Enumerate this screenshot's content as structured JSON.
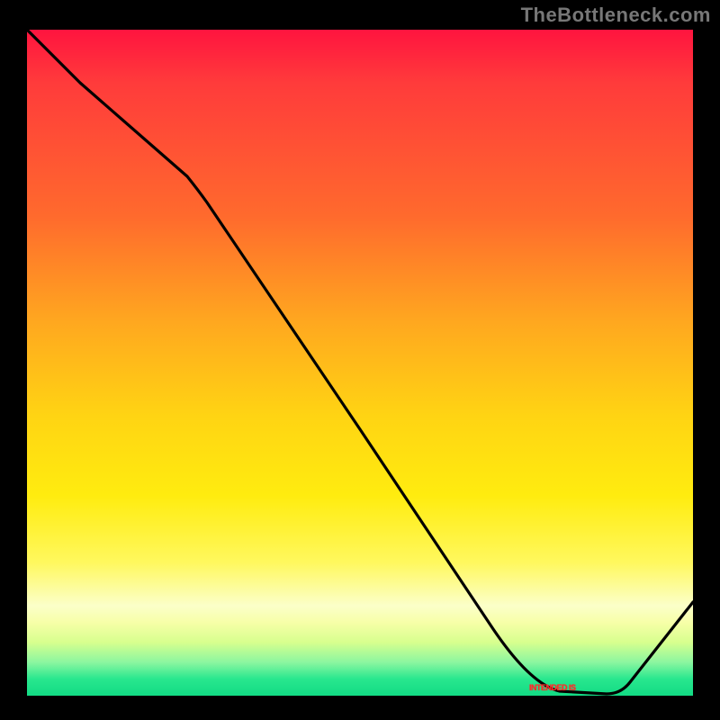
{
  "attribution": "TheBottleneck.com",
  "bottom_label": "INTENDED IS",
  "colors": {
    "frame_border": "#000000",
    "line_stroke": "#000000",
    "attribution_text": "#777777",
    "bottom_label_text": "#ff2a2a"
  },
  "chart_data": {
    "type": "line",
    "title": "",
    "xlabel": "",
    "ylabel": "",
    "xlim": [
      0,
      100
    ],
    "ylim": [
      0,
      100
    ],
    "x": [
      0,
      8,
      24,
      50,
      70,
      80,
      87,
      100
    ],
    "values": [
      100,
      92,
      78,
      40,
      10,
      1,
      0,
      14
    ],
    "series": [
      {
        "name": "curve",
        "values": [
          100,
          92,
          78,
          40,
          10,
          1,
          0,
          14
        ]
      }
    ],
    "annotations": [
      {
        "text": "INTENDED IS",
        "x": 82,
        "y": 0
      }
    ],
    "background_gradient": [
      "#ff143f",
      "#ff6a2d",
      "#ffd413",
      "#fff85e",
      "#fbffc9",
      "#28e78e"
    ]
  }
}
